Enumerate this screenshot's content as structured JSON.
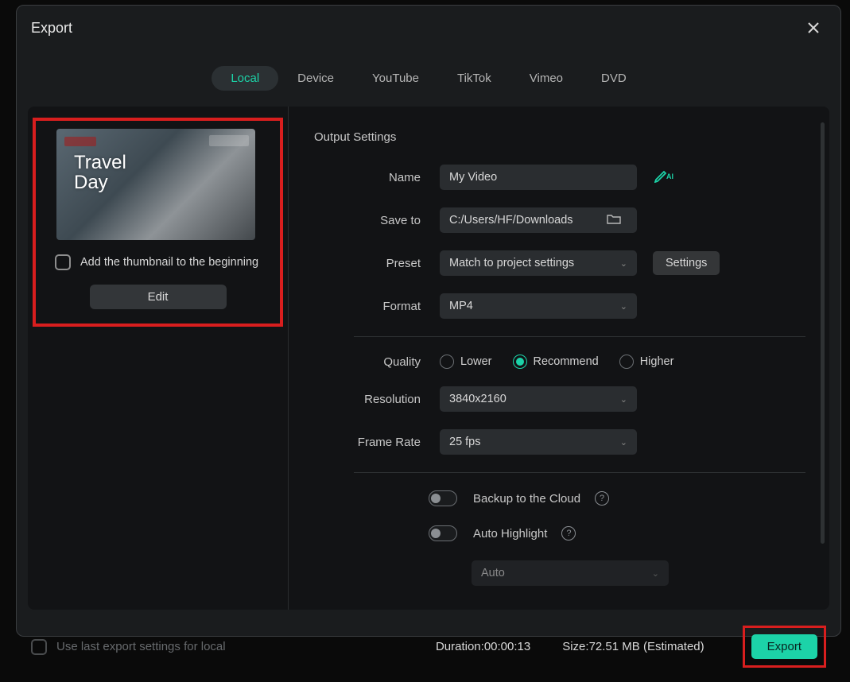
{
  "modal": {
    "title": "Export",
    "tabs": {
      "local": "Local",
      "device": "Device",
      "youtube": "YouTube",
      "tiktok": "TikTok",
      "vimeo": "Vimeo",
      "dvd": "DVD"
    }
  },
  "thumbnail": {
    "overlay_line1": "Travel",
    "overlay_line2": "Day",
    "add_thumbnail_label": "Add the thumbnail to the beginning",
    "edit_label": "Edit"
  },
  "settings": {
    "section_title": "Output Settings",
    "name_label": "Name",
    "name_value": "My Video",
    "saveto_label": "Save to",
    "saveto_value": "C:/Users/HF/Downloads",
    "preset_label": "Preset",
    "preset_value": "Match to project settings",
    "settings_btn": "Settings",
    "format_label": "Format",
    "format_value": "MP4",
    "quality_label": "Quality",
    "quality_lower": "Lower",
    "quality_recommend": "Recommend",
    "quality_higher": "Higher",
    "resolution_label": "Resolution",
    "resolution_value": "3840x2160",
    "framerate_label": "Frame Rate",
    "framerate_value": "25 fps",
    "backup_label": "Backup to the Cloud",
    "autohighlight_label": "Auto Highlight",
    "auto_value": "Auto"
  },
  "footer": {
    "use_last_label": "Use last export settings for local",
    "duration_label": "Duration:",
    "duration_value": "00:00:13",
    "size_label": "Size:",
    "size_value": "72.51 MB",
    "size_suffix": "(Estimated)",
    "export_btn": "Export"
  }
}
